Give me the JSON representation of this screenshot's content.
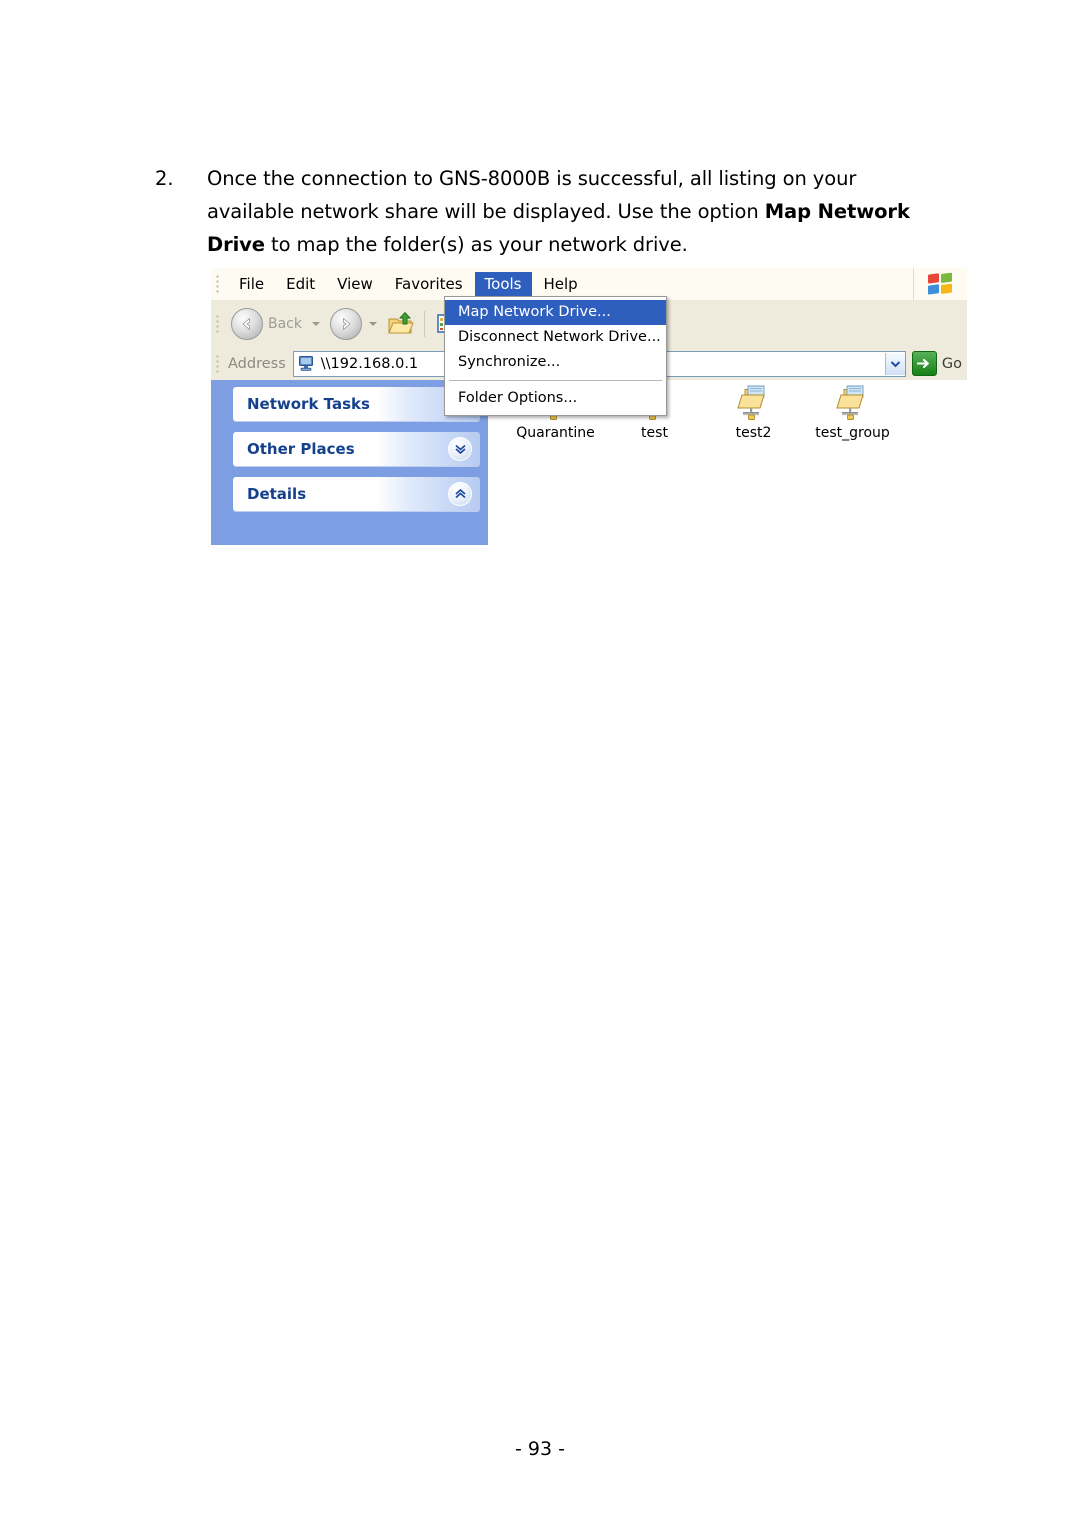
{
  "document": {
    "step_number": "2.",
    "step_text_part1": "Once the connection to GNS-8000B is successful, all listing on your available network share will be displayed.  Use the option ",
    "step_text_bold": "Map Network Drive",
    "step_text_part2": " to map the folder(s) as your network drive.",
    "page_number": "- 93 -"
  },
  "screenshot": {
    "menubar": {
      "items": [
        {
          "label": "File"
        },
        {
          "label": "Edit"
        },
        {
          "label": "View"
        },
        {
          "label": "Favorites"
        },
        {
          "label": "Tools"
        },
        {
          "label": "Help"
        }
      ],
      "active_item": "Tools",
      "windows_logo": "windows-flag-icon"
    },
    "toolbar": {
      "back_label": "Back",
      "back_icon": "arrow-left-icon",
      "forward_icon": "arrow-right-icon",
      "up_icon": "up-one-level-folder-icon",
      "views_icon": "views-icon",
      "delete_icon": "red-x-delete-icon"
    },
    "address": {
      "label": "Address",
      "value": "\\\\192.168.0.1",
      "placeholder": "",
      "computer_icon": "network-computer-icon",
      "dropdown_icon": "chevron-down-icon",
      "go_label": "Go",
      "go_icon": "green-arrow-go-icon"
    },
    "dropdown_menu": {
      "items": [
        {
          "label": "Map Network Drive...",
          "selected": true
        },
        {
          "label": "Disconnect Network Drive...",
          "selected": false
        },
        {
          "label": "Synchronize...",
          "selected": false
        },
        {
          "label": "Folder Options...",
          "selected": false
        }
      ],
      "separator_after_index": 2
    },
    "sidebar": {
      "panels": [
        {
          "title": "Network Tasks",
          "chevron": "chevron-double-down-icon",
          "expanded": false
        },
        {
          "title": "Other Places",
          "chevron": "chevron-double-down-icon",
          "expanded": false
        },
        {
          "title": "Details",
          "chevron": "chevron-double-up-icon",
          "expanded": true
        }
      ]
    },
    "content": {
      "shares": [
        {
          "name": "Quarantine",
          "icon": "network-share-folder-icon"
        },
        {
          "name": "test",
          "icon": "network-share-folder-icon"
        },
        {
          "name": "test2",
          "icon": "network-share-folder-icon"
        },
        {
          "name": "test_group",
          "icon": "network-share-folder-icon"
        }
      ]
    },
    "colors": {
      "menu_highlight": "#2f5fbe",
      "sidebar_background": "#7e9ee3",
      "panel_title": "#15418c",
      "toolbar_background": "#eeebdd",
      "menubar_background": "#fdfbf2",
      "go_button_green": "#178017",
      "delete_red": "#d8391c"
    }
  }
}
